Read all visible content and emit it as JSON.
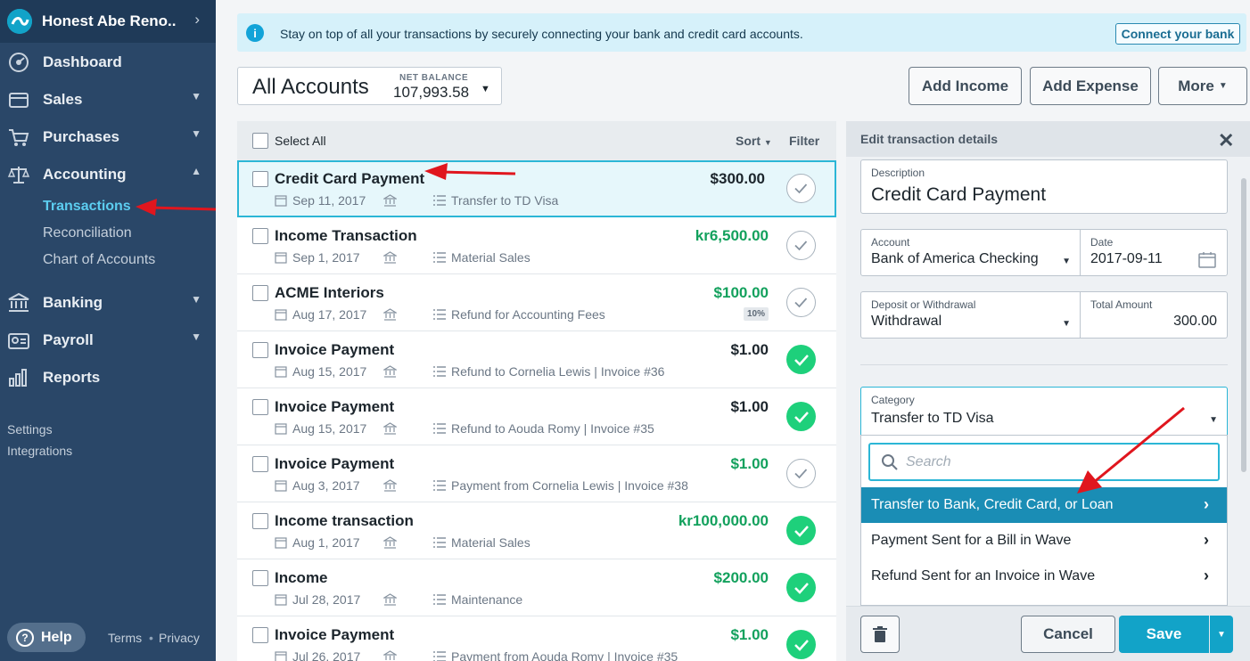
{
  "sidebar": {
    "business_name": "Honest Abe Reno...",
    "nav": [
      {
        "label": "Dashboard",
        "icon": "dashboard-icon",
        "chevron": ""
      },
      {
        "label": "Sales",
        "icon": "sales-icon",
        "chevron": "⌄"
      },
      {
        "label": "Purchases",
        "icon": "cart-icon",
        "chevron": "⌄"
      },
      {
        "label": "Accounting",
        "icon": "scale-icon",
        "chevron": "⌃"
      },
      {
        "label": "Banking",
        "icon": "bank-icon",
        "chevron": "⌄"
      },
      {
        "label": "Payroll",
        "icon": "payroll-icon",
        "chevron": "⌄"
      },
      {
        "label": "Reports",
        "icon": "reports-icon",
        "chevron": ""
      }
    ],
    "accounting_sub": [
      "Transactions",
      "Reconciliation",
      "Chart of Accounts"
    ],
    "settings": "Settings",
    "integrations": "Integrations",
    "help": "Help",
    "terms": "Terms",
    "privacy": "Privacy"
  },
  "banner": {
    "text": "Stay on top of all your transactions by securely connecting your bank and credit card accounts.",
    "button": "Connect your bank"
  },
  "account": {
    "name": "All Accounts",
    "net_balance_label": "NET BALANCE",
    "net_balance": "107,993.58"
  },
  "toolbar": {
    "add_income": "Add Income",
    "add_expense": "Add Expense",
    "more": "More"
  },
  "list": {
    "select_all": "Select All",
    "sort": "Sort",
    "filter": "Filter",
    "rows": [
      {
        "title": "Credit Card Payment",
        "date": "Sep 11, 2017",
        "category": "Transfer to TD Visa",
        "amount": "$300.00",
        "green": false,
        "status": "unreviewed",
        "tax": ""
      },
      {
        "title": "Income Transaction",
        "date": "Sep 1, 2017",
        "category": "Material Sales",
        "amount": "kr6,500.00",
        "green": true,
        "status": "unreviewed",
        "tax": ""
      },
      {
        "title": "ACME Interiors",
        "date": "Aug 17, 2017",
        "category": "Refund for Accounting Fees",
        "amount": "$100.00",
        "green": true,
        "status": "unreviewed",
        "tax": "10%"
      },
      {
        "title": "Invoice Payment",
        "date": "Aug 15, 2017",
        "category": "Refund to Cornelia Lewis | Invoice #36",
        "amount": "$1.00",
        "green": false,
        "status": "reviewed",
        "tax": ""
      },
      {
        "title": "Invoice Payment",
        "date": "Aug 15, 2017",
        "category": "Refund to Aouda Romy | Invoice #35",
        "amount": "$1.00",
        "green": false,
        "status": "reviewed",
        "tax": ""
      },
      {
        "title": "Invoice Payment",
        "date": "Aug 3, 2017",
        "category": "Payment from Cornelia Lewis | Invoice #38",
        "amount": "$1.00",
        "green": true,
        "status": "unreviewed",
        "tax": ""
      },
      {
        "title": "Income transaction",
        "date": "Aug 1, 2017",
        "category": "Material Sales",
        "amount": "kr100,000.00",
        "green": true,
        "status": "reviewed",
        "tax": ""
      },
      {
        "title": "Income",
        "date": "Jul 28, 2017",
        "category": "Maintenance",
        "amount": "$200.00",
        "green": true,
        "status": "reviewed",
        "tax": ""
      },
      {
        "title": "Invoice Payment",
        "date": "Jul 26, 2017",
        "category": "Payment from Aouda Romy | Invoice #35",
        "amount": "$1.00",
        "green": true,
        "status": "reviewed",
        "tax": ""
      }
    ]
  },
  "panel": {
    "title": "Edit transaction details",
    "description_label": "Description",
    "description_value": "Credit Card Payment",
    "account_label": "Account",
    "account_value": "Bank of America Checking",
    "date_label": "Date",
    "date_value": "2017-09-11",
    "dw_label": "Deposit or Withdrawal",
    "dw_value": "Withdrawal",
    "amount_label": "Total Amount",
    "amount_value": "300.00",
    "category_label": "Category",
    "category_value": "Transfer to TD Visa",
    "search_placeholder": "Search",
    "options": [
      "Transfer to Bank, Credit Card, or Loan",
      "Payment Sent for a Bill in Wave",
      "Refund Sent for an Invoice in Wave"
    ],
    "cancel": "Cancel",
    "save": "Save"
  },
  "colors": {
    "sidebar": "#2a4768",
    "accent": "#12a3c8",
    "positive": "#13a15d",
    "reviewed": "#1ed07b",
    "annotation_arrow": "#e0161e"
  }
}
